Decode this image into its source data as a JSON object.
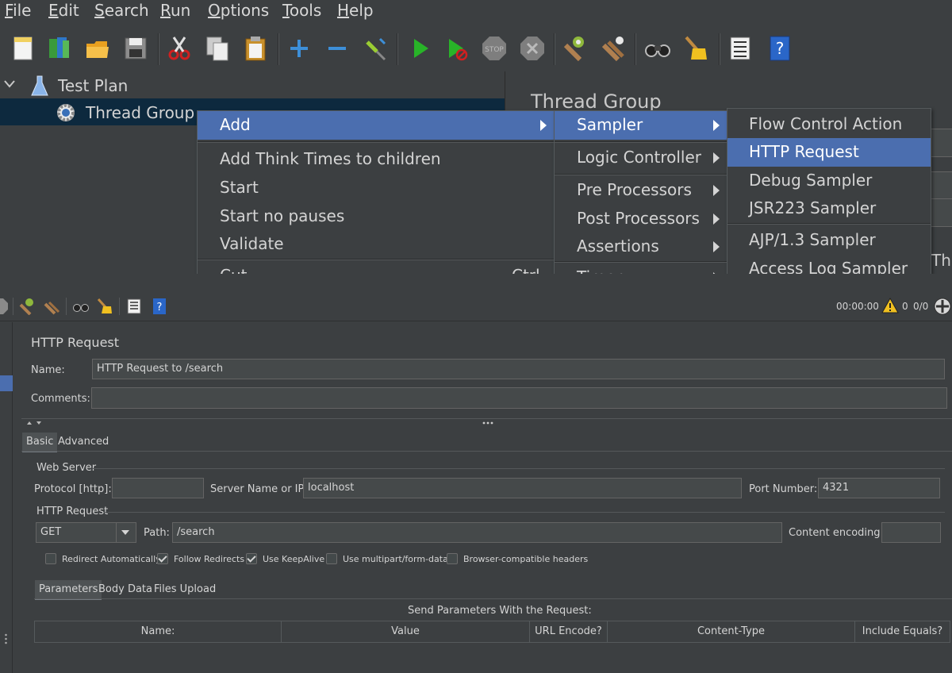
{
  "menubar": {
    "items": [
      {
        "pre": "",
        "u": "F",
        "post": "ile"
      },
      {
        "pre": "",
        "u": "E",
        "post": "dit"
      },
      {
        "pre": "",
        "u": "S",
        "post": "earch"
      },
      {
        "pre": "",
        "u": "R",
        "post": "un"
      },
      {
        "pre": "",
        "u": "O",
        "post": "ptions"
      },
      {
        "pre": "",
        "u": "T",
        "post": "ools"
      },
      {
        "pre": "",
        "u": "H",
        "post": "elp"
      }
    ]
  },
  "tree": {
    "test_plan": "Test Plan",
    "thread_group": "Thread Group"
  },
  "right_pane": {
    "title": "Thread Group",
    "partial_label": "Thr"
  },
  "context_menu": {
    "items": [
      "Add",
      "Add Think Times to children",
      "Start",
      "Start no pauses",
      "Validate",
      "Cut"
    ],
    "shortcut": "Ctrl-X"
  },
  "add_submenu": {
    "items": [
      "Sampler",
      "Logic Controller",
      "Pre Processors",
      "Post Processors",
      "Assertions",
      "Timer"
    ]
  },
  "sampler_submenu": {
    "items": [
      "Flow Control Action",
      "HTTP Request",
      "Debug Sampler",
      "JSR223 Sampler",
      "AJP/1.3 Sampler",
      "Access Log Sampler"
    ]
  },
  "status": {
    "time": "00:00:00",
    "warnings": "0",
    "threads": "0/0"
  },
  "editor": {
    "title": "HTTP Request",
    "name_label": "Name:",
    "name_value": "HTTP Request to /search",
    "comments_label": "Comments:",
    "comments_value": "",
    "tabs": [
      "Basic",
      "Advanced"
    ],
    "web_server": {
      "group_label": "Web Server",
      "protocol_label": "Protocol [http]:",
      "protocol_value": "",
      "server_label": "Server Name or IP:",
      "server_value": "localhost",
      "port_label": "Port Number:",
      "port_value": "4321"
    },
    "http_request": {
      "group_label": "HTTP Request",
      "method": "GET",
      "path_label": "Path:",
      "path_value": "/search",
      "encoding_label": "Content encoding:",
      "encoding_value": ""
    },
    "checkboxes": [
      {
        "label": "Redirect Automatically",
        "checked": false
      },
      {
        "label": "Follow Redirects",
        "checked": true
      },
      {
        "label": "Use KeepAlive",
        "checked": true
      },
      {
        "label": "Use multipart/form-data",
        "checked": false
      },
      {
        "label": "Browser-compatible headers",
        "checked": false
      }
    ],
    "sub_tabs": [
      "Parameters",
      "Body Data",
      "Files Upload"
    ],
    "params_caption": "Send Parameters With the Request:",
    "columns": [
      "Name:",
      "Value",
      "URL Encode?",
      "Content-Type",
      "Include Equals?"
    ]
  },
  "colors": {
    "background": "#3c3f41",
    "selection": "#4b6eaf",
    "tree_selection": "#0d293e",
    "input_bg": "#45494a"
  },
  "icons": [
    "new-icon",
    "templates-icon",
    "open-icon",
    "save-icon",
    "cut-icon",
    "copy-icon",
    "paste-icon",
    "expand-icon",
    "collapse-icon",
    "toggle-icon",
    "start-icon",
    "start-no-pauses-icon",
    "stop-icon",
    "shutdown-icon",
    "clear-icon",
    "clear-all-icon",
    "search-icon",
    "reset-search-icon",
    "function-helper-icon",
    "help-icon"
  ]
}
